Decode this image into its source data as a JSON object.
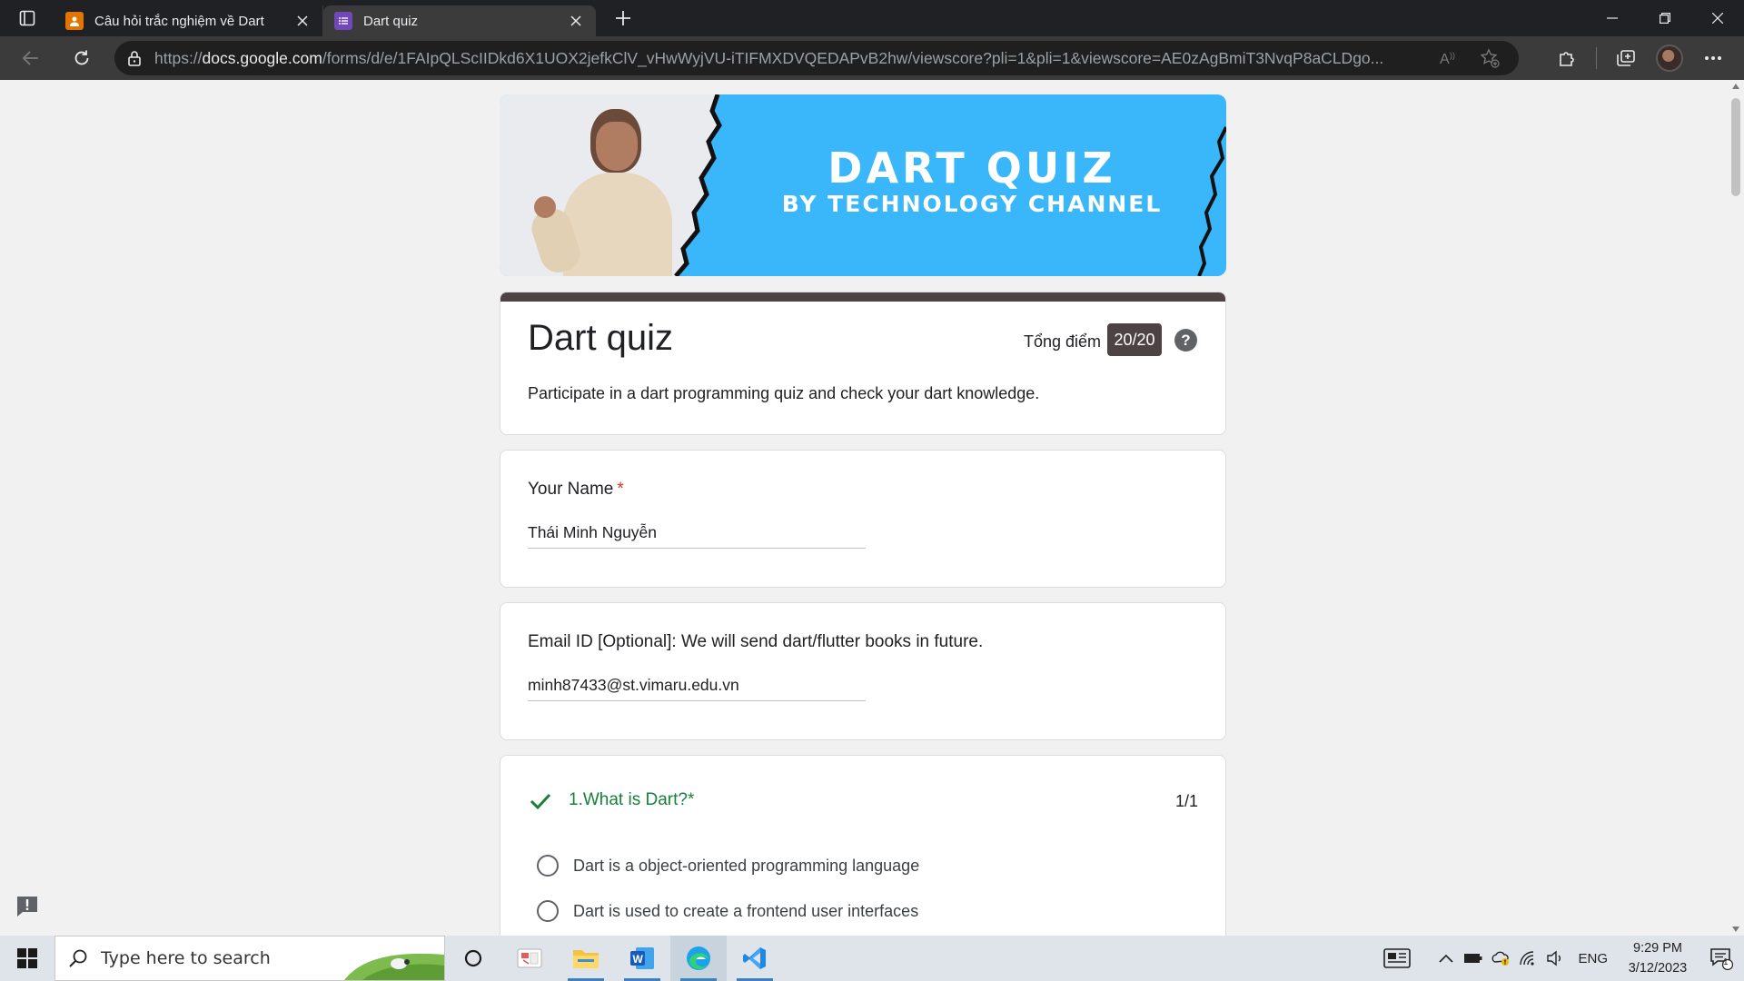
{
  "browser": {
    "tabs": [
      {
        "title": "Câu hỏi trắc nghiệm về Dart",
        "favicon": "classroom-icon",
        "active": false
      },
      {
        "title": "Dart quiz",
        "favicon": "forms-icon",
        "active": true
      }
    ],
    "url": {
      "scheme": "https://",
      "host": "docs.google.com",
      "path": "/forms/d/e/1FAIpQLScIIDkd6X1UOX2jefkClV_vHwWyjVU-iTIFMXDVQEDAPvB2hw/viewscore?pli=1&pli=1&viewscore=AE0zAgBmiT3NvqP8aCLDgo..."
    }
  },
  "banner": {
    "line1": "DART QUIZ",
    "line2": "BY TECHNOLOGY CHANNEL"
  },
  "form": {
    "title": "Dart quiz",
    "score_label": "Tổng điểm",
    "score": "20/20",
    "help": "?",
    "description": "Participate in a dart programming quiz and check your dart knowledge."
  },
  "questions": [
    {
      "title": "Your Name",
      "required_mark": "*",
      "answer": "Thái Minh Nguyễn"
    },
    {
      "title": "Email ID [Optional]: We will send dart/flutter books in future.",
      "answer": "minh87433@st.vimaru.edu.vn"
    }
  ],
  "quiz": {
    "question": "1.What is Dart?",
    "required_mark": "*",
    "points": "1/1",
    "options": [
      "Dart is a object-oriented programming language",
      "Dart is used to create a frontend user interfaces"
    ]
  },
  "taskbar": {
    "search_placeholder": "Type here to search",
    "lang": "ENG",
    "time": "9:29 PM",
    "date": "3/12/2023",
    "notifications": "1"
  },
  "colors": {
    "accent": "#4e4344",
    "correct": "#188038",
    "required": "#d93025",
    "banner": "#3ab6fb"
  }
}
